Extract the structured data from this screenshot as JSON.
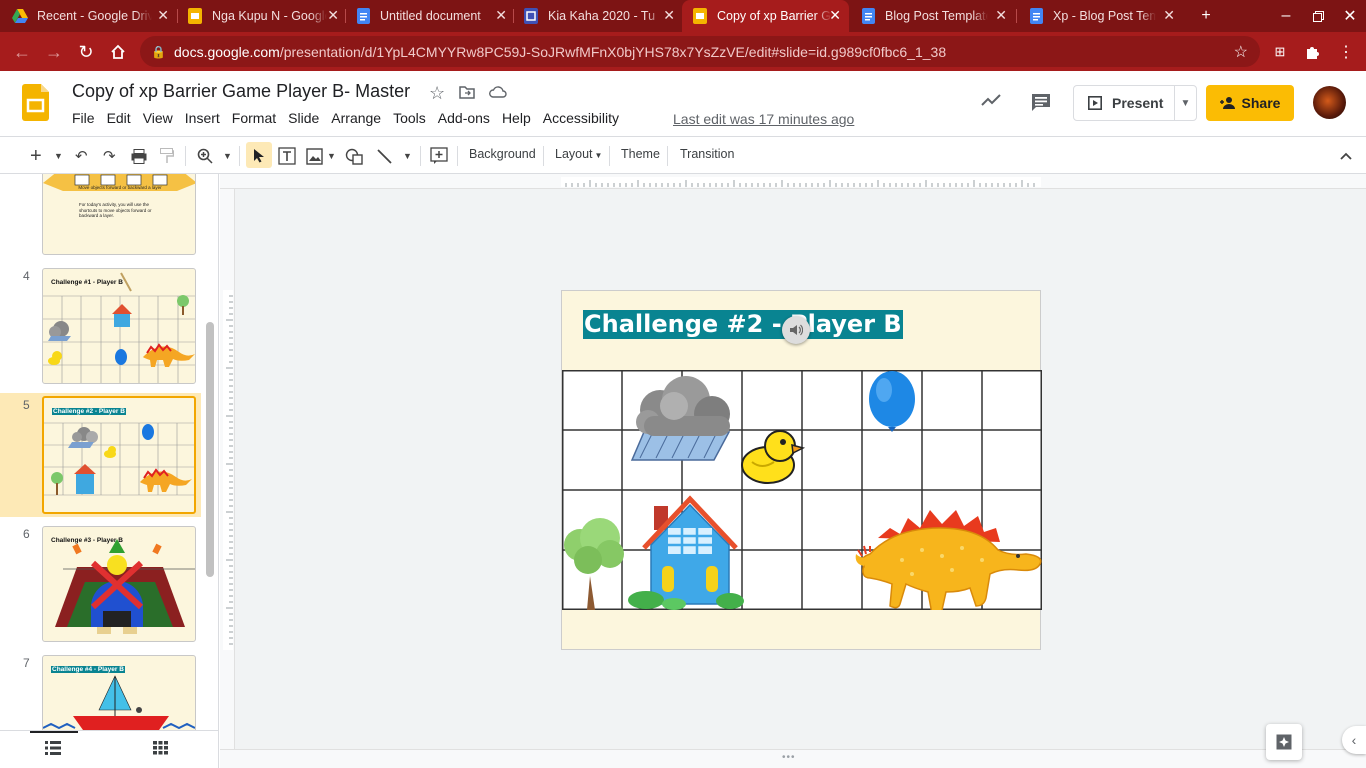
{
  "browser": {
    "tabs": [
      {
        "title": "Recent - Google Drive",
        "icon": "drive-icon"
      },
      {
        "title": "Nga Kupu N - Google Slides",
        "icon": "slides-icon"
      },
      {
        "title": "Untitled document",
        "icon": "docs-icon"
      },
      {
        "title": "Kia Kaha 2020 - Tu",
        "icon": "forms-icon"
      },
      {
        "title": "Copy of xp Barrier Game",
        "icon": "slides-icon",
        "active": true
      },
      {
        "title": "Blog Post Template",
        "icon": "docs-icon"
      },
      {
        "title": "Xp - Blog Post Template",
        "icon": "docs-icon"
      }
    ],
    "url_host": "docs.google.com",
    "url_path": "/presentation/d/1YpL4CMYYRw8PC59J-SoJRwfMFnX0bjYHS78x7YsZzVE/edit#slide=id.g989cf0fbc6_1_38"
  },
  "app": {
    "doc_title": "Copy of xp Barrier Game Player B- Master",
    "menus": [
      "File",
      "Edit",
      "View",
      "Insert",
      "Format",
      "Slide",
      "Arrange",
      "Tools",
      "Add-ons",
      "Help",
      "Accessibility"
    ],
    "last_edit": "Last edit was 17 minutes ago",
    "present_label": "Present",
    "share_label": "Share"
  },
  "toolbar": {
    "background_label": "Background",
    "layout_label": "Layout",
    "theme_label": "Theme",
    "transition_label": "Transition"
  },
  "filmstrip": {
    "slides": [
      {
        "number": "",
        "caption": "Move objects forward or backward a layer",
        "body": "For today's activity, you will use the shortcuts to move objects forward or backward a layer."
      },
      {
        "number": "4",
        "title": "Challenge #1 - Player B"
      },
      {
        "number": "5",
        "title": "Challenge #2 - Player B",
        "selected": true
      },
      {
        "number": "6",
        "title": "Challenge #3 - Player B"
      },
      {
        "number": "7",
        "title": "Challenge #4 - Player B"
      }
    ]
  },
  "slide": {
    "title": "Challenge #2 - Player B",
    "grid_columns": 8,
    "grid_rows": 4
  },
  "colors": {
    "tab_strip": "#7d1414",
    "address_bar": "#a61c1c",
    "title_highlight": "#098491",
    "slide_bg": "#fcf6dd",
    "share": "#fbbc04"
  }
}
